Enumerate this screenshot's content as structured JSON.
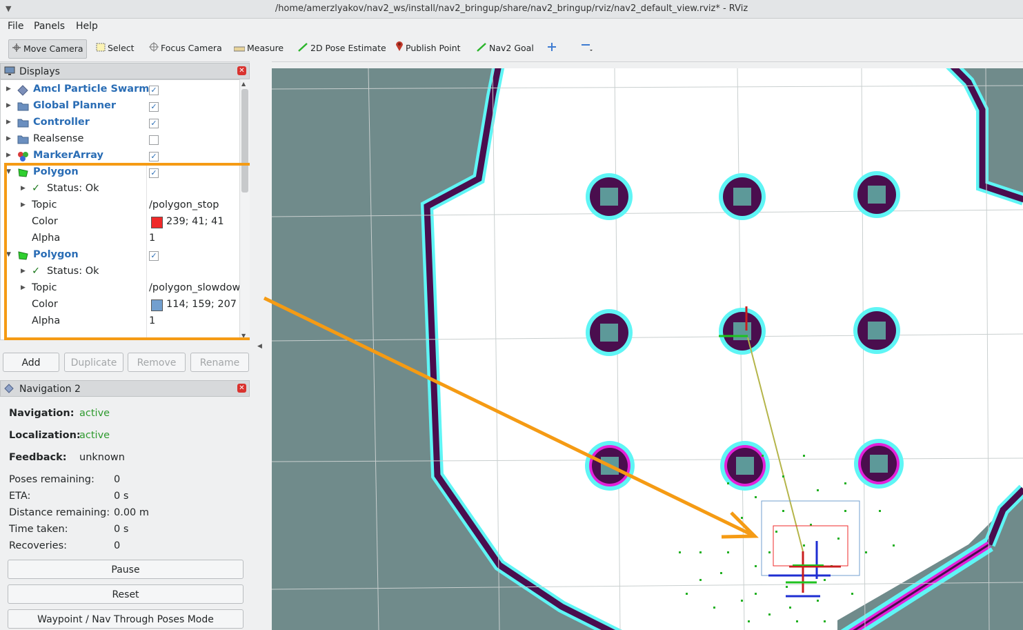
{
  "window": {
    "title": "/home/amerzlyakov/nav2_ws/install/nav2_bringup/share/nav2_bringup/rviz/nav2_default_view.rviz* - RViz"
  },
  "menu": [
    "File",
    "Panels",
    "Help"
  ],
  "toolbar": {
    "move_camera": "Move Camera",
    "select": "Select",
    "focus_camera": "Focus Camera",
    "measure": "Measure",
    "pose_estimate": "2D Pose Estimate",
    "publish_point": "Publish Point",
    "nav2_goal": "Nav2 Goal"
  },
  "displays": {
    "title": "Displays",
    "items": [
      {
        "label": "Amcl Particle Swarm",
        "checked": true
      },
      {
        "label": "Global Planner",
        "checked": true
      },
      {
        "label": "Controller",
        "checked": true
      },
      {
        "label": "Realsense",
        "checked": false
      },
      {
        "label": "MarkerArray",
        "checked": true
      }
    ],
    "polygon1": {
      "label": "Polygon",
      "status": "Status: Ok",
      "topic_label": "Topic",
      "topic": "/polygon_stop",
      "color_label": "Color",
      "color": "239; 41; 41",
      "swatch": "#ef2929",
      "alpha_label": "Alpha",
      "alpha": "1"
    },
    "polygon2": {
      "label": "Polygon",
      "status": "Status: Ok",
      "topic_label": "Topic",
      "topic": "/polygon_slowdowi",
      "color_label": "Color",
      "color": "114; 159; 207",
      "swatch": "#729fcf",
      "alpha_label": "Alpha",
      "alpha": "1"
    },
    "buttons": {
      "add": "Add",
      "duplicate": "Duplicate",
      "remove": "Remove",
      "rename": "Rename"
    }
  },
  "navigation": {
    "title": "Navigation 2",
    "navigation_label": "Navigation:",
    "navigation_value": "active",
    "localization_label": "Localization:",
    "localization_value": "active",
    "feedback_label": "Feedback:",
    "feedback_value": "unknown",
    "poses_label": "Poses remaining:",
    "poses_value": "0",
    "eta_label": "ETA:",
    "eta_value": "0 s",
    "distance_label": "Distance remaining:",
    "distance_value": "0.00 m",
    "time_label": "Time taken:",
    "time_value": "0 s",
    "recoveries_label": "Recoveries:",
    "recoveries_value": "0",
    "pause": "Pause",
    "reset": "Reset",
    "waypoint": "Waypoint / Nav Through Poses Mode"
  },
  "colors": {
    "highlight": "#f59b14",
    "obstacle": "#4a0e4e",
    "inflation": "#5ff5f5",
    "grid_bg": "#708b8b"
  }
}
